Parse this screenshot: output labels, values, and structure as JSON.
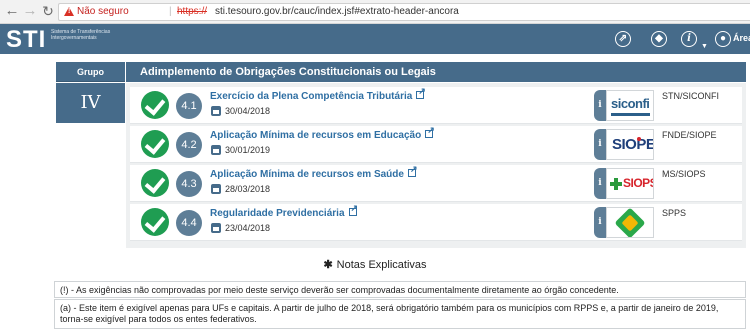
{
  "browser": {
    "security_label": "Não seguro",
    "url_scheme": "https://",
    "url_rest": "sti.tesouro.gov.br/cauc/index.jsf#extrato-header-ancora"
  },
  "header": {
    "logo": "STI",
    "logo_subtitle": "Sistema de Transferências Intergovernamentais",
    "area_label": "Área I",
    "bg_color": "#466b8a"
  },
  "group": {
    "column_label": "Grupo",
    "numeral": "IV",
    "title": "Adimplemento de Obrigações Constitucionais ou Legais"
  },
  "items": [
    {
      "num": "4.1",
      "title": "Exercício da Plena Competência Tributária",
      "date": "30/04/2018",
      "source": "STN/SICONFI",
      "logo": "siconfi",
      "status": "ok"
    },
    {
      "num": "4.2",
      "title": "Aplicação Mínima de recursos em Educação",
      "date": "30/01/2019",
      "source": "FNDE/SIOPE",
      "logo": "SIOPE",
      "status": "ok"
    },
    {
      "num": "4.3",
      "title": "Aplicação Mínima de recursos em Saúde",
      "date": "28/03/2018",
      "source": "MS/SIOPS",
      "logo": "SIOPS",
      "status": "ok"
    },
    {
      "num": "4.4",
      "title": "Regularidade Previdenciária",
      "date": "23/04/2018",
      "source": "SPPS",
      "logo": "spps",
      "status": "ok"
    }
  ],
  "notes": {
    "title": "Notas Explicativas",
    "note_1": "(!) - As exigências não comprovadas por meio deste serviço deverão ser comprovadas documentalmente diretamente ao órgão concedente.",
    "note_2": "(a) - Este item é exigível apenas para UFs e capitais. A partir de julho de 2018, será obrigatório também para os municípios com RPPS e, a partir de janeiro de 2019, torna-se exigível para todos os entes federativos."
  },
  "colors": {
    "check": "#1f9d52",
    "badge": "#5e7e97",
    "link": "#2f6fa3"
  }
}
